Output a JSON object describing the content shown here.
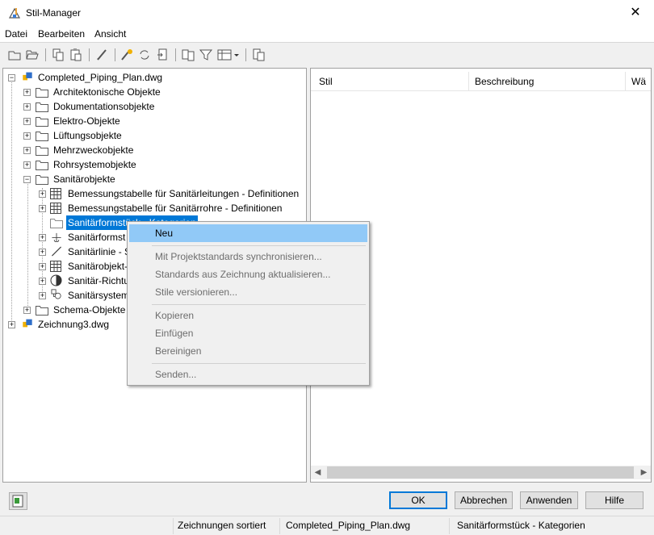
{
  "window": {
    "title": "Stil-Manager",
    "close_glyph": "✕"
  },
  "menu": [
    "Datei",
    "Bearbeiten",
    "Ansicht"
  ],
  "tree": {
    "drawing1": "Completed_Piping_Plan.dwg",
    "categories": [
      "Architektonische Objekte",
      "Dokumentationsobjekte",
      "Elektro-Objekte",
      "Lüftungsobjekte",
      "Mehrzweckobjekte",
      "Rohrsystemobjekte",
      "Sanitärobjekte"
    ],
    "sanitaer_children": [
      "Bemessungstabelle für Sanitärleitungen - Definitionen",
      "Bemessungstabelle für Sanitärrohre - Definitionen",
      "Sanitärformstück - Kategorien",
      "Sanitärformst",
      "Sanitärlinie - S",
      "Sanitärobjekt-",
      "Sanitär-Richtu",
      "Sanitärsystem"
    ],
    "schema": "Schema-Objekte",
    "drawing2": "Zeichnung3.dwg"
  },
  "list": {
    "columns": [
      "Stil",
      "Beschreibung",
      "Wä"
    ]
  },
  "context_menu": {
    "items": [
      "Neu",
      "Mit Projektstandards synchronisieren...",
      "Standards aus Zeichnung aktualisieren...",
      "Stile versionieren...",
      "Kopieren",
      "Einfügen",
      "Bereinigen",
      "Senden..."
    ]
  },
  "buttons": {
    "ok": "OK",
    "cancel": "Abbrechen",
    "apply": "Anwenden",
    "help": "Hilfe"
  },
  "status": {
    "sort": "Zeichnungen sortiert",
    "drawing": "Completed_Piping_Plan.dwg",
    "selection": "Sanitärformstück - Kategorien"
  },
  "colors": {
    "selection": "#0078d7",
    "menu_highlight": "#91c9f7",
    "folder": "#dcb67a"
  }
}
